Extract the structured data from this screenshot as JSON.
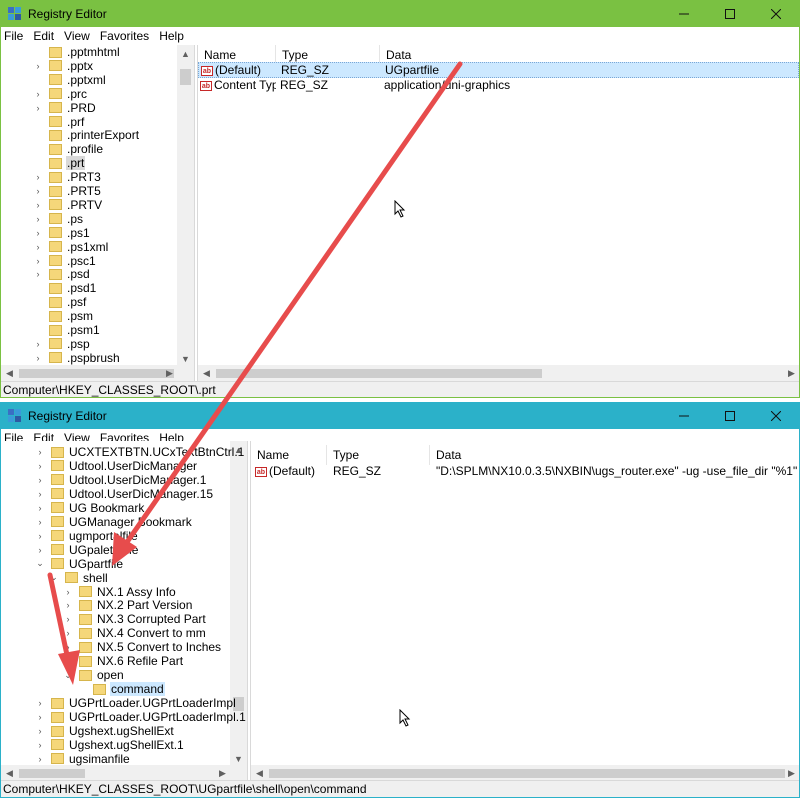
{
  "window1": {
    "title": "Registry Editor",
    "menu": [
      "File",
      "Edit",
      "View",
      "Favorites",
      "Help"
    ],
    "tree": [
      {
        "label": ".pptmhtml",
        "expander": ""
      },
      {
        "label": ".pptx",
        "expander": ">"
      },
      {
        "label": ".pptxml",
        "expander": ""
      },
      {
        "label": ".prc",
        "expander": ">"
      },
      {
        "label": ".PRD",
        "expander": ">"
      },
      {
        "label": ".prf",
        "expander": ""
      },
      {
        "label": ".printerExport",
        "expander": ""
      },
      {
        "label": ".profile",
        "expander": ""
      },
      {
        "label": ".prt",
        "expander": ""
      },
      {
        "label": ".PRT3",
        "expander": ">"
      },
      {
        "label": ".PRT5",
        "expander": ">"
      },
      {
        "label": ".PRTV",
        "expander": ">"
      },
      {
        "label": ".ps",
        "expander": ">"
      },
      {
        "label": ".ps1",
        "expander": ">"
      },
      {
        "label": ".ps1xml",
        "expander": ">"
      },
      {
        "label": ".psc1",
        "expander": ">"
      },
      {
        "label": ".psd",
        "expander": ">"
      },
      {
        "label": ".psd1",
        "expander": ""
      },
      {
        "label": ".psf",
        "expander": ""
      },
      {
        "label": ".psm",
        "expander": ""
      },
      {
        "label": ".psm1",
        "expander": ""
      },
      {
        "label": ".psp",
        "expander": ">"
      },
      {
        "label": ".pspbrush",
        "expander": ">"
      }
    ],
    "columns": {
      "name": "Name",
      "type": "Type",
      "data": "Data"
    },
    "values": [
      {
        "name": "(Default)",
        "type": "REG_SZ",
        "data": "UGpartfile"
      },
      {
        "name": "Content Type",
        "type": "REG_SZ",
        "data": "application/uni-graphics"
      }
    ],
    "status": "Computer\\HKEY_CLASSES_ROOT\\.prt"
  },
  "window2": {
    "title": "Registry Editor",
    "menu": [
      "File",
      "Edit",
      "View",
      "Favorites",
      "Help"
    ],
    "tree": [
      {
        "label": "UCXTEXTBTN.UCxTextBtnCtrl.1",
        "expander": ">"
      },
      {
        "label": "Udtool.UserDicManager",
        "expander": ">"
      },
      {
        "label": "Udtool.UserDicManager.1",
        "expander": ">"
      },
      {
        "label": "Udtool.UserDicManager.15",
        "expander": ">"
      },
      {
        "label": "UG Bookmark",
        "expander": ">"
      },
      {
        "label": "UGManager Bookmark",
        "expander": ">"
      },
      {
        "label": "ugmportalfile",
        "expander": ">"
      },
      {
        "label": "UGpalettefile",
        "expander": ">"
      },
      {
        "label": "UGpartfile",
        "expander": "v"
      },
      {
        "label": "shell",
        "expander": "v"
      },
      {
        "label": "NX.1 Assy Info",
        "expander": ">"
      },
      {
        "label": "NX.2 Part Version",
        "expander": ">"
      },
      {
        "label": "NX.3 Corrupted Part",
        "expander": ">"
      },
      {
        "label": "NX.4 Convert to mm",
        "expander": ">"
      },
      {
        "label": "NX.5 Convert to Inches",
        "expander": ">"
      },
      {
        "label": "NX.6 Refile Part",
        "expander": ">"
      },
      {
        "label": "open",
        "expander": "v"
      },
      {
        "label": "command",
        "expander": ""
      },
      {
        "label": "UGPrtLoader.UGPrtLoaderImpl",
        "expander": ">"
      },
      {
        "label": "UGPrtLoader.UGPrtLoaderImpl.1",
        "expander": ">"
      },
      {
        "label": "Ugshext.ugShellExt",
        "expander": ">"
      },
      {
        "label": "Ugshext.ugShellExt.1",
        "expander": ">"
      },
      {
        "label": "ugsimanfile",
        "expander": ">"
      }
    ],
    "columns": {
      "name": "Name",
      "type": "Type",
      "data": "Data"
    },
    "values": [
      {
        "name": "(Default)",
        "type": "REG_SZ",
        "data": "\"D:\\SPLM\\NX10.0.3.5\\NXBIN\\ugs_router.exe\"  -ug -use_file_dir  \"%1\""
      }
    ],
    "status": "Computer\\HKEY_CLASSES_ROOT\\UGpartfile\\shell\\open\\command"
  },
  "colors": {
    "window1_title": "#7ac142",
    "window2_title": "#2bb1c9",
    "arrow": "#e74c4c",
    "selection": "#cce8ff"
  },
  "icons": [
    "registry-editor-icon",
    "minimize-icon",
    "maximize-icon",
    "close-icon",
    "folder-icon",
    "string-value-icon",
    "mouse-cursor-icon"
  ]
}
